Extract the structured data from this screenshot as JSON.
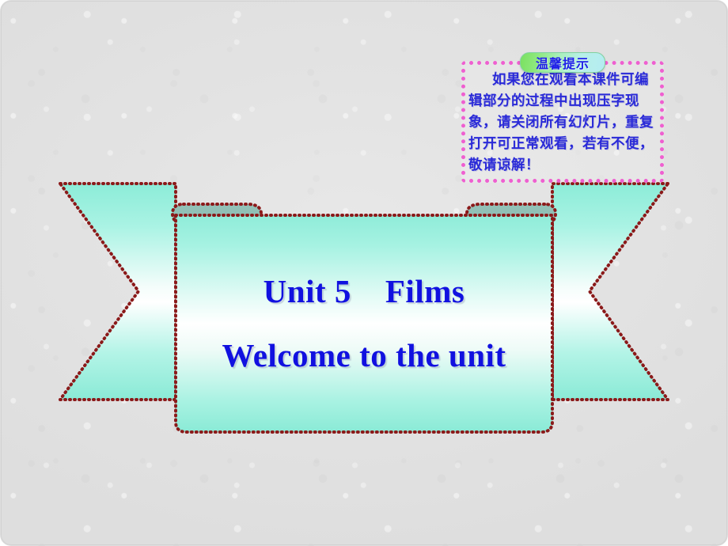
{
  "slide": {
    "background_color": "#e3e3e3",
    "title_line1": "Unit 5    Films",
    "title_line2": "Welcome to the unit",
    "title_color": "#1111e0"
  },
  "banner": {
    "name": "ribbon-banner",
    "fill_top_color": "#9df0de",
    "fill_mid_color": "#ffffff",
    "fill_bottom_color": "#8fecd8",
    "fold_color": "#8fbfb5",
    "border_color": "#8b1a1a",
    "border_style": "dotted"
  },
  "tip": {
    "badge_label": "温馨提示",
    "badge_color_start": "#7ae060",
    "badge_color_end": "#b4ecf2",
    "badge_text_color": "#2020e8",
    "border_color": "#ef5fd0",
    "text_color": "#2a2ad8",
    "body": "如果您在观看本课件可编辑部分的过程中出现压字现象，请关闭所有幻灯片，重复打开可正常观看，若有不便，敬请谅解！"
  }
}
